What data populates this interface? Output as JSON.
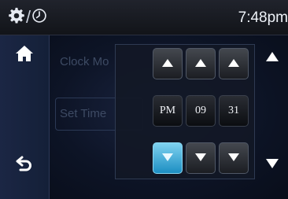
{
  "header": {
    "time": "7:48pm"
  },
  "background": {
    "clock_mode_label": "Clock Mo",
    "set_time_label": "Set Time"
  },
  "time_picker": {
    "meridiem": "PM",
    "hour": "09",
    "minute": "31"
  },
  "colors": {
    "accent": "#3aa9dc",
    "topbar": "#1a1d24",
    "sidebar": "#18233f"
  },
  "icons": {
    "settings": "gear-icon",
    "clock": "clock-icon",
    "home": "home-icon",
    "back": "back-arrow-icon",
    "increment": "triangle-up-icon",
    "decrement": "triangle-down-icon"
  }
}
